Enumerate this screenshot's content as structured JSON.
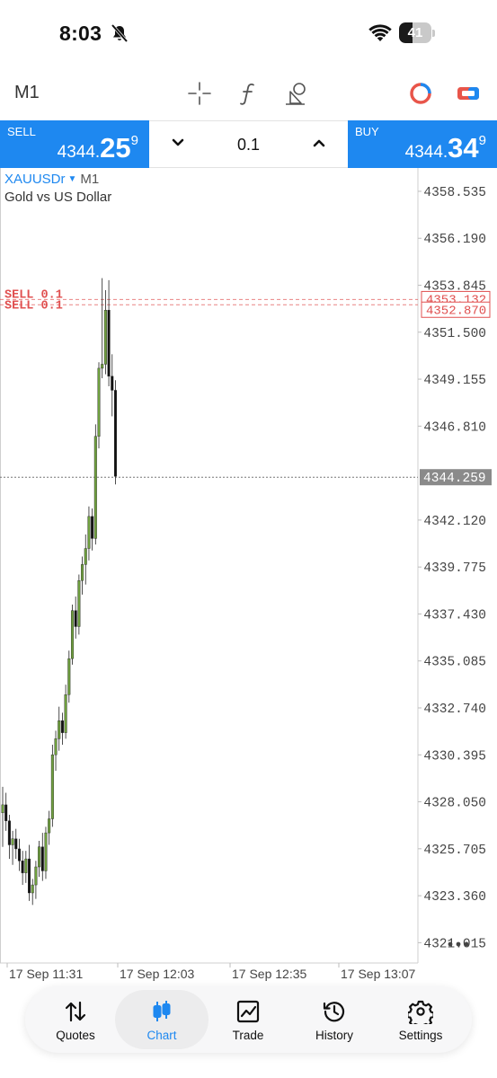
{
  "status_bar": {
    "time": "8:03",
    "battery": "41",
    "battery_level": 0.41
  },
  "toolbar": {
    "timeframe": "M1"
  },
  "trade": {
    "sell_label": "SELL",
    "sell_price_main": "4344.",
    "sell_price_big": "25",
    "sell_price_sup": "9",
    "buy_label": "BUY",
    "buy_price_main": "4344.",
    "buy_price_big": "34",
    "buy_price_sup": "9",
    "lot": "0.1"
  },
  "symbol": {
    "name": "XAUUSDr",
    "timeframe": "M1",
    "description": "Gold vs US Dollar"
  },
  "colors": {
    "accent": "#1e88f0",
    "bull_candle": "#6fa03e",
    "order_line": "#e05050",
    "price_tag": "#8a8a8a"
  },
  "chart_data": {
    "type": "candlestick",
    "y_tick_labels": [
      "4358.535",
      "4356.190",
      "4353.845",
      "4351.500",
      "4349.155",
      "4346.810",
      "4344.259",
      "4342.120",
      "4339.775",
      "4337.430",
      "4335.085",
      "4332.740",
      "4330.395",
      "4328.050",
      "4325.705",
      "4323.360",
      "4321.015"
    ],
    "y_ticks": [
      4358.535,
      4356.19,
      4353.845,
      4351.5,
      4349.155,
      4346.81,
      4342.12,
      4339.775,
      4337.43,
      4335.085,
      4332.74,
      4330.395,
      4328.05,
      4325.705,
      4323.36,
      4321.015
    ],
    "ylim": [
      4320.0,
      4359.7
    ],
    "x_tick_labels": [
      "17 Sep 11:31",
      "17 Sep 12:03",
      "17 Sep 12:35",
      "17 Sep 13:07"
    ],
    "bid_price": 4344.259,
    "bid_label": "4344.259",
    "orders": [
      {
        "label": "SELL 0.1",
        "price": 4353.132,
        "price_label": "4353.132"
      },
      {
        "label": "SELL 0.1",
        "price": 4352.87,
        "price_label": "4352.870"
      }
    ],
    "candles": [
      {
        "o": 4327.5,
        "h": 4328.8,
        "l": 4325.8,
        "c": 4327.9
      },
      {
        "o": 4327.9,
        "h": 4328.5,
        "l": 4326.6,
        "c": 4327.1
      },
      {
        "o": 4327.1,
        "h": 4327.4,
        "l": 4325.2,
        "c": 4325.9
      },
      {
        "o": 4325.9,
        "h": 4326.6,
        "l": 4324.9,
        "c": 4326.2
      },
      {
        "o": 4326.2,
        "h": 4326.7,
        "l": 4325.2,
        "c": 4325.7
      },
      {
        "o": 4325.7,
        "h": 4326.2,
        "l": 4324.6,
        "c": 4325.1
      },
      {
        "o": 4325.1,
        "h": 4325.6,
        "l": 4323.9,
        "c": 4324.5
      },
      {
        "o": 4324.5,
        "h": 4325.6,
        "l": 4324.0,
        "c": 4325.2
      },
      {
        "o": 4325.2,
        "h": 4325.9,
        "l": 4323.1,
        "c": 4323.5
      },
      {
        "o": 4323.5,
        "h": 4324.2,
        "l": 4322.9,
        "c": 4323.9
      },
      {
        "o": 4323.9,
        "h": 4325.1,
        "l": 4323.2,
        "c": 4324.8
      },
      {
        "o": 4324.8,
        "h": 4326.1,
        "l": 4324.3,
        "c": 4325.8
      },
      {
        "o": 4325.8,
        "h": 4326.5,
        "l": 4324.1,
        "c": 4324.6
      },
      {
        "o": 4324.6,
        "h": 4326.8,
        "l": 4324.2,
        "c": 4326.5
      },
      {
        "o": 4326.5,
        "h": 4327.6,
        "l": 4325.9,
        "c": 4327.2
      },
      {
        "o": 4327.2,
        "h": 4330.9,
        "l": 4326.8,
        "c": 4330.4
      },
      {
        "o": 4330.4,
        "h": 4331.6,
        "l": 4329.6,
        "c": 4331.2
      },
      {
        "o": 4331.2,
        "h": 4332.8,
        "l": 4330.6,
        "c": 4332.1
      },
      {
        "o": 4332.1,
        "h": 4332.5,
        "l": 4330.9,
        "c": 4331.5
      },
      {
        "o": 4331.5,
        "h": 4333.9,
        "l": 4331.2,
        "c": 4333.4
      },
      {
        "o": 4333.4,
        "h": 4335.6,
        "l": 4333.0,
        "c": 4335.2
      },
      {
        "o": 4335.2,
        "h": 4337.9,
        "l": 4334.9,
        "c": 4337.6
      },
      {
        "o": 4337.6,
        "h": 4338.3,
        "l": 4336.2,
        "c": 4336.8
      },
      {
        "o": 4336.8,
        "h": 4339.4,
        "l": 4336.4,
        "c": 4339.1
      },
      {
        "o": 4339.1,
        "h": 4340.3,
        "l": 4338.4,
        "c": 4339.9
      },
      {
        "o": 4339.9,
        "h": 4341.4,
        "l": 4338.9,
        "c": 4340.7
      },
      {
        "o": 4340.7,
        "h": 4342.8,
        "l": 4340.1,
        "c": 4342.3
      },
      {
        "o": 4342.3,
        "h": 4342.7,
        "l": 4340.6,
        "c": 4341.2
      },
      {
        "o": 4341.2,
        "h": 4346.9,
        "l": 4340.9,
        "c": 4346.3
      },
      {
        "o": 4346.3,
        "h": 4350.0,
        "l": 4345.7,
        "c": 4349.7
      },
      {
        "o": 4349.7,
        "h": 4354.2,
        "l": 4349.2,
        "c": 4349.9
      },
      {
        "o": 4349.9,
        "h": 4353.6,
        "l": 4349.4,
        "c": 4352.6
      },
      {
        "o": 4352.6,
        "h": 4354.1,
        "l": 4348.8,
        "c": 4349.3
      },
      {
        "o": 4349.3,
        "h": 4350.4,
        "l": 4347.3,
        "c": 4348.6
      },
      {
        "o": 4348.6,
        "h": 4349.1,
        "l": 4343.9,
        "c": 4344.3
      }
    ]
  },
  "nav": [
    {
      "label": "Quotes",
      "icon": "quotes-icon"
    },
    {
      "label": "Chart",
      "icon": "chart-icon",
      "active": true
    },
    {
      "label": "Trade",
      "icon": "trade-icon"
    },
    {
      "label": "History",
      "icon": "history-icon"
    },
    {
      "label": "Settings",
      "icon": "settings-icon"
    }
  ]
}
